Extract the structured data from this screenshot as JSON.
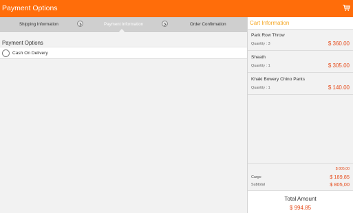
{
  "appbar": {
    "title": "Payment Options",
    "cart_icon": "cart-icon",
    "color": "#ff6d0a"
  },
  "steps": [
    {
      "label": "Shipping Information",
      "active": false
    },
    {
      "label": "Payment Information",
      "active": true
    },
    {
      "label": "Order Confirmation",
      "active": false
    }
  ],
  "payment": {
    "title": "Payment Options",
    "options": [
      {
        "label": "Cash On Delivery",
        "selected": false
      }
    ]
  },
  "cart": {
    "title": "Cart Information",
    "items": [
      {
        "name": "Park Row Throw",
        "quantity": "Quantity : 3",
        "price": "$ 360.00"
      },
      {
        "name": "Sheath",
        "quantity": "Quantity : 1",
        "price": "$ 305.00"
      },
      {
        "name": "Khaki Bowery Chino Pants",
        "quantity": "Quantity : 1",
        "price": "$ 140.00"
      }
    ],
    "items_total": "$ 805,00",
    "cargo_label": "Cargo",
    "cargo_value": "$ 189,85",
    "subtotal_label": "Subtotal",
    "subtotal_value": "$ 805,00",
    "total_label": "Total Amount",
    "total_value": "$ 994.85"
  }
}
